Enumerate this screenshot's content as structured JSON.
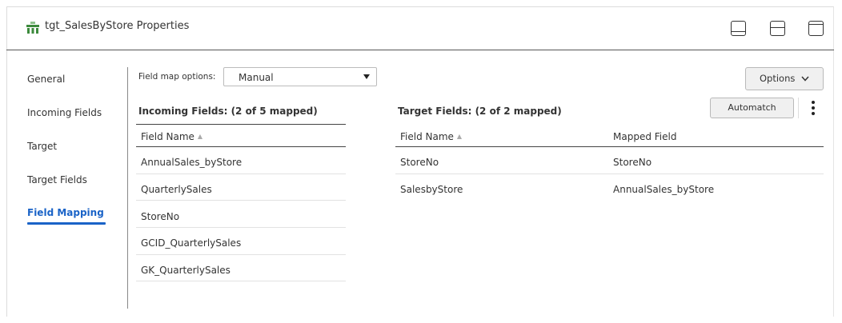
{
  "header": {
    "title": "tgt_SalesByStore Properties",
    "title_icon": "table-target-icon",
    "view_buttons": [
      "panel-bottom-icon",
      "panel-split-icon",
      "panel-top-icon"
    ]
  },
  "sidebar": {
    "items": [
      {
        "label": "General",
        "active": false
      },
      {
        "label": "Incoming Fields",
        "active": false
      },
      {
        "label": "Target",
        "active": false
      },
      {
        "label": "Target Fields",
        "active": false
      },
      {
        "label": "Field Mapping",
        "active": true
      }
    ],
    "accent_color": "#1a63c7"
  },
  "field_map": {
    "label": "Field map options:",
    "selected": "Manual"
  },
  "options_button": {
    "label": "Options",
    "icon": "chevron-down-icon"
  },
  "automatch_button": {
    "label": "Automatch"
  },
  "more_button": {
    "icon": "more-vertical-icon"
  },
  "incoming": {
    "title": "Incoming Fields: (2 of 5 mapped)",
    "column": "Field Name",
    "rows": [
      "AnnualSales_byStore",
      "QuarterlySales",
      "StoreNo",
      "GCID_QuarterlySales",
      "GK_QuarterlySales"
    ]
  },
  "target": {
    "title": "Target Fields: (2 of 2 mapped)",
    "columns": [
      "Field Name",
      "Mapped Field"
    ],
    "rows": [
      {
        "field": "StoreNo",
        "mapped": "StoreNo"
      },
      {
        "field": "SalesbyStore",
        "mapped": "AnnualSales_byStore"
      }
    ]
  }
}
